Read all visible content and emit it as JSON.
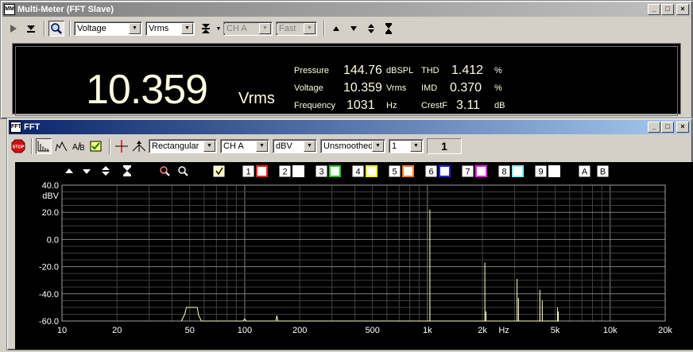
{
  "meter_window": {
    "title": "Multi-Meter (FFT Slave)",
    "icon_text": "MM",
    "function_select": "Voltage",
    "unit_select": "Vrms",
    "channel_select": "CH A",
    "speed_select": "Fast",
    "reading_value": "10.359",
    "reading_unit": "Vrms",
    "readouts": [
      {
        "label": "Pressure",
        "value": "144.76",
        "unit": "dBSPL"
      },
      {
        "label": "Voltage",
        "value": "10.359",
        "unit": "Vrms"
      },
      {
        "label": "Frequency",
        "value": "1031",
        "unit": "Hz"
      }
    ],
    "readouts_right": [
      {
        "label": "THD",
        "value": "1.412",
        "unit": "%"
      },
      {
        "label": "IMD",
        "value": "0.370",
        "unit": "%"
      },
      {
        "label": "CrestF",
        "value": "3.11",
        "unit": "dB"
      }
    ]
  },
  "fft_window": {
    "title": "FFT",
    "icon_text": "FFT",
    "stop_label": "STOP",
    "window_select": "Rectangular",
    "channel_select": "CH A",
    "unit_select": "dBV",
    "smoothing_select": "Unsmoothed",
    "average_select": "1",
    "average_count": "1",
    "trace_buttons": [
      "1",
      "2",
      "3",
      "4",
      "5",
      "6",
      "7",
      "8",
      "9"
    ],
    "trace_colors": [
      "#ff2020",
      "#ffffff",
      "#20d020",
      "#ffff00",
      "#ff8020",
      "#2020ff",
      "#ff20ff",
      "#80ffff",
      "#ffffff"
    ],
    "marker_buttons": [
      "A",
      "B"
    ],
    "icon_colors": {
      "accent": "#0a246a",
      "trace_main": "#fffcc0"
    }
  },
  "chart_data": {
    "type": "line",
    "xscale": "log",
    "xlim": [
      10,
      20000
    ],
    "ylim": [
      -60,
      40
    ],
    "x_ticks": [
      {
        "v": 10,
        "t": "10"
      },
      {
        "v": 20,
        "t": "20"
      },
      {
        "v": 50,
        "t": "50"
      },
      {
        "v": 100,
        "t": "100"
      },
      {
        "v": 200,
        "t": "200"
      },
      {
        "v": 500,
        "t": "500"
      },
      {
        "v": 1000,
        "t": "1k"
      },
      {
        "v": 2000,
        "t": "2k"
      },
      {
        "v": 5000,
        "t": "5k"
      },
      {
        "v": 10000,
        "t": "10k"
      },
      {
        "v": 20000,
        "t": "20k"
      }
    ],
    "x_unit": "Hz",
    "y_ticks": [
      {
        "v": 40,
        "t": "40.0"
      },
      {
        "v": 20,
        "t": "20.0"
      },
      {
        "v": 0,
        "t": "0.0"
      },
      {
        "v": -20,
        "t": "-20.0"
      },
      {
        "v": -40,
        "t": "-40.0"
      },
      {
        "v": -60,
        "t": "-60.0"
      }
    ],
    "ylabel": "dBV",
    "grid": true,
    "series": [
      {
        "color": "#fffcc0",
        "points": [
          [
            45,
            -60
          ],
          [
            47,
            -55
          ],
          [
            48,
            -50
          ],
          [
            55,
            -50
          ],
          [
            56,
            -56
          ],
          [
            58,
            -60
          ],
          [
            98,
            -60
          ],
          [
            100,
            -58.5
          ],
          [
            102,
            -60
          ],
          [
            148,
            -60
          ],
          [
            150,
            -56
          ],
          [
            152,
            -60
          ],
          [
            1031,
            -60
          ],
          [
            1031,
            22
          ],
          [
            1032,
            -60
          ],
          [
            2062,
            -60
          ],
          [
            2062,
            -17
          ],
          [
            2063,
            -60
          ],
          [
            2090,
            -60
          ],
          [
            2090,
            -53
          ],
          [
            2091,
            -60
          ],
          [
            3093,
            -60
          ],
          [
            3093,
            -29
          ],
          [
            3094,
            -60
          ],
          [
            3150,
            -60
          ],
          [
            3150,
            -43
          ],
          [
            3151,
            -60
          ],
          [
            4124,
            -60
          ],
          [
            4124,
            -37
          ],
          [
            4125,
            -60
          ],
          [
            4250,
            -60
          ],
          [
            4250,
            -45
          ],
          [
            4251,
            -60
          ],
          [
            5155,
            -60
          ],
          [
            5155,
            -50
          ],
          [
            5156,
            -60
          ],
          [
            5200,
            -60
          ],
          [
            5200,
            -53
          ],
          [
            5201,
            -60
          ]
        ]
      }
    ]
  }
}
